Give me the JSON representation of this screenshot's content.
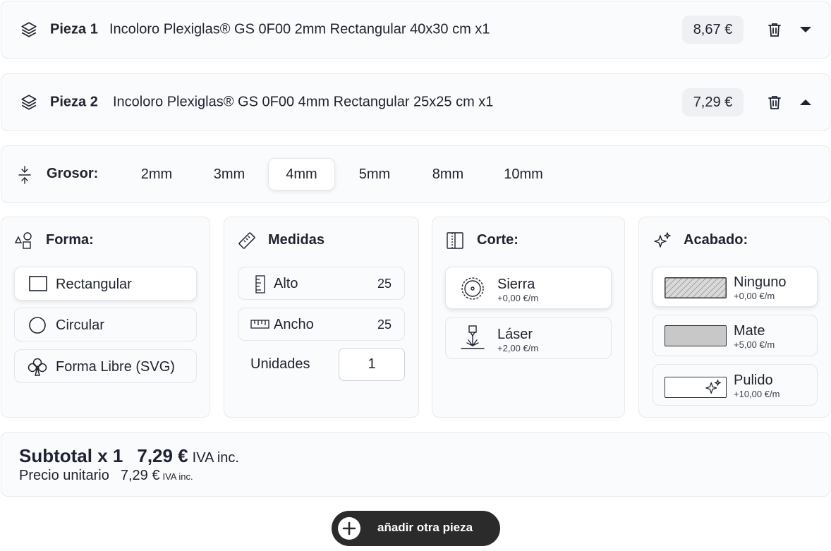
{
  "pieces": [
    {
      "name": "Pieza 1",
      "description": "Incoloro Plexiglas® GS 0F00 2mm Rectangular 40x30 cm x1",
      "price": "8,67 €",
      "expanded": false
    },
    {
      "name": "Pieza 2",
      "description": "Incoloro Plexiglas® GS 0F00 4mm Rectangular 25x25 cm x1",
      "price": "7,29 €",
      "expanded": true
    }
  ],
  "thickness": {
    "label": "Grosor:",
    "options": [
      "2mm",
      "3mm",
      "4mm",
      "5mm",
      "8mm",
      "10mm"
    ],
    "selected": "4mm"
  },
  "shape": {
    "title": "Forma:",
    "options": [
      "Rectangular",
      "Circular",
      "Forma Libre (SVG)"
    ],
    "selected": "Rectangular"
  },
  "measures": {
    "title": "Medidas",
    "height_label": "Alto",
    "height_value": "25",
    "width_label": "Ancho",
    "width_value": "25",
    "units_label": "Unidades",
    "units_value": "1"
  },
  "cut": {
    "title": "Corte:",
    "options": [
      {
        "label": "Sierra",
        "price": "+0,00 €/m"
      },
      {
        "label": "Láser",
        "price": "+2,00 €/m"
      }
    ],
    "selected": "Sierra"
  },
  "finish": {
    "title": "Acabado:",
    "options": [
      {
        "label": "Ninguno",
        "price": "+0,00 €/m"
      },
      {
        "label": "Mate",
        "price": "+5,00 €/m"
      },
      {
        "label": "Pulido",
        "price": "+10,00 €/m"
      }
    ],
    "selected": "Ninguno"
  },
  "summary": {
    "subtotal_label": "Subtotal x 1",
    "subtotal_price": "7,29 €",
    "subtotal_tax": "IVA inc.",
    "unit_label": "Precio unitario",
    "unit_price": "7,29 €",
    "unit_tax": "IVA inc."
  },
  "add_button": {
    "label": "añadir otra pieza"
  },
  "colors": {
    "dark": "#2b2b2b",
    "border": "#e8eaee",
    "card_bg": "#fafbfc",
    "swatch_mate": "#c8c8c8"
  }
}
